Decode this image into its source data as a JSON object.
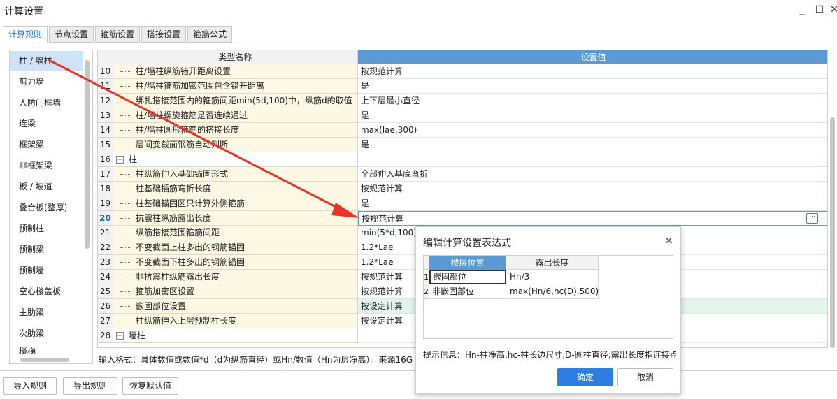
{
  "window": {
    "title": "计算设置",
    "minimize": "_",
    "maximize": "☐",
    "close": "✕"
  },
  "tabs": [
    "计算规则",
    "节点设置",
    "箍筋设置",
    "搭接设置",
    "箍筋公式"
  ],
  "left_list": [
    "柱 / 墙柱",
    "剪力墙",
    "人防门框墙",
    "连梁",
    "框架梁",
    "非框架梁",
    "板 / 坡道",
    "叠合板(整厚)",
    "预制柱",
    "预制梁",
    "预制墙",
    "空心楼盖板",
    "主肋梁",
    "次肋梁",
    "楼梯"
  ],
  "grid": {
    "header_name": "类型名称",
    "header_value": "设置值",
    "rows": [
      {
        "num": "10",
        "name": "柱/墙柱纵筋错开距离设置",
        "value": "按规范计算"
      },
      {
        "num": "11",
        "name": "柱/墙柱箍筋加密范围包含错开距离",
        "value": "是"
      },
      {
        "num": "12",
        "name": "绑扎搭接范围内的箍筋间距min(5d,100)中，纵筋d的取值",
        "value": "上下层最小直径"
      },
      {
        "num": "13",
        "name": "柱/墙柱螺旋箍筋是否连续通过",
        "value": "是"
      },
      {
        "num": "14",
        "name": "柱/墙柱圆形箍筋的搭接长度",
        "value": "max(lae,300)"
      },
      {
        "num": "15",
        "name": "层间变截面钢筋自动判断",
        "value": "是"
      },
      {
        "num": "16",
        "name": "柱",
        "value": "",
        "group": true
      },
      {
        "num": "17",
        "name": "柱纵筋伸入基础锚固形式",
        "value": "全部伸入基底弯折"
      },
      {
        "num": "18",
        "name": "柱基础插筋弯折长度",
        "value": "按规范计算"
      },
      {
        "num": "19",
        "name": "柱基础锚固区只计算外侧箍筋",
        "value": "是"
      },
      {
        "num": "20",
        "name": "抗震柱纵筋露出长度",
        "value": "按规范计算",
        "current": true
      },
      {
        "num": "21",
        "name": "纵筋搭接范围箍筋间距",
        "value": "min(5*d,100)"
      },
      {
        "num": "22",
        "name": "不变截面上柱多出的钢筋锚固",
        "value": "1.2*Lae"
      },
      {
        "num": "23",
        "name": "不变截面下柱多出的钢筋锚固",
        "value": "1.2*Lae"
      },
      {
        "num": "24",
        "name": "非抗震柱纵筋露出长度",
        "value": "按规范计算"
      },
      {
        "num": "25",
        "name": "箍筋加密区设置",
        "value": "按规范计算"
      },
      {
        "num": "26",
        "name": "嵌固部位设置",
        "value": "按设定计算",
        "green": true
      },
      {
        "num": "27",
        "name": "柱纵筋伸入上层预制柱长度",
        "value": "按设定计算"
      },
      {
        "num": "28",
        "name": "墙柱",
        "value": "",
        "group": true
      }
    ]
  },
  "hint": "输入格式：具体数值或数值*d（d为纵筋直径）或Hn/数值（Hn为层净高）。来源16G",
  "buttons": {
    "import": "导入规则",
    "export": "导出规则",
    "restore": "恢复默认值"
  },
  "dialog": {
    "title": "编辑计算设置表达式",
    "close": "✕",
    "col_a": "楼层位置",
    "col_b": "露出长度",
    "rows": [
      {
        "num": "1",
        "position": "嵌固部位",
        "length": "Hn/3"
      },
      {
        "num": "2",
        "position": "非嵌固部位",
        "length": "max(Hn/6,hc(D),500)"
      }
    ],
    "hint": "提示信息：Hn-柱净高,hc-柱长边尺寸,D-圆柱直径;露出长度指连接点",
    "ok": "确定",
    "cancel": "取消"
  },
  "colors": {
    "accent": "#5b9bd5",
    "primary_button": "#2d7ee0",
    "arrow": "#e8352a"
  }
}
